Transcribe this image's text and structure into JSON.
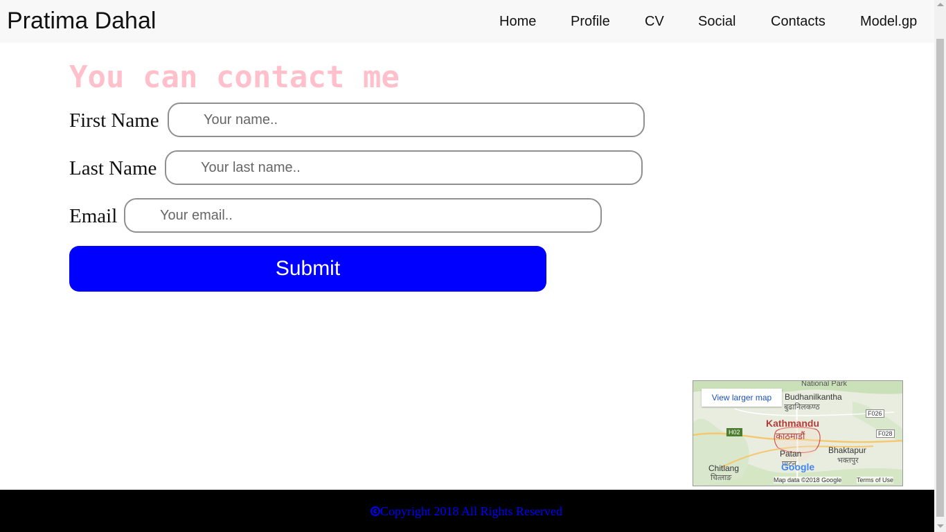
{
  "navbar": {
    "brand": "Pratima Dahal",
    "items": [
      {
        "label": "Home"
      },
      {
        "label": "Profile"
      },
      {
        "label": "CV"
      },
      {
        "label": "Social"
      },
      {
        "label": "Contacts"
      },
      {
        "label": "Model.gp"
      }
    ]
  },
  "form": {
    "heading": "You can contact me",
    "first_name": {
      "label": "First Name",
      "placeholder": "Your name..",
      "value": ""
    },
    "last_name": {
      "label": "Last Name",
      "placeholder": "Your last name..",
      "value": ""
    },
    "email": {
      "label": "Email",
      "placeholder": "Your email..",
      "value": ""
    },
    "submit_label": "Submit"
  },
  "map": {
    "view_larger": "View larger map",
    "places": {
      "national_park": "National Park",
      "budhanilkantha": "Budhanilkantha",
      "budhanilkantha_np": "बुढानिलकण्ठ",
      "kathmandu": "Kathmandu",
      "kathmandu_np": "काठमाडौं",
      "patan": "Patan",
      "patan_np": "पाटन",
      "bhaktapur": "Bhaktapur",
      "bhaktapur_np": "भक्तपुर",
      "chitlang": "Chitlang",
      "chitlang_np": "चित्लाङ"
    },
    "roads": {
      "h02": "H02",
      "f026": "F026",
      "f028": "F028"
    },
    "logo": "Google",
    "attribution": "Map data ©2018 Google",
    "terms": "Terms of Use"
  },
  "footer": {
    "copyright": "Copyright 2018 All Rights Reserved",
    "color": "#0000ff"
  },
  "colors": {
    "heading": "#ffc0cb",
    "submit_bg": "#0000ff",
    "footer_bg": "#000000",
    "navbar_bg": "#f8f8f8"
  }
}
